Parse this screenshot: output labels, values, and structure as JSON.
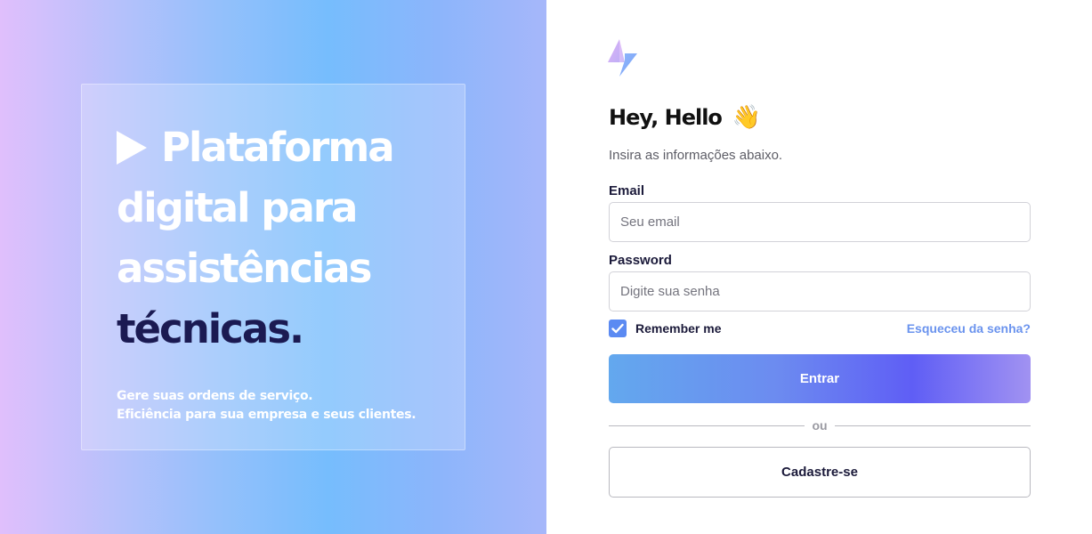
{
  "hero": {
    "headline_line1": "Plataforma",
    "headline_line2": "digital para",
    "headline_line3": "assistências",
    "headline_line4": "técnicas.",
    "subtext_line1": "Gere suas ordens de serviço.",
    "subtext_line2": "Eficiência para sua empresa e seus clientes.",
    "play_icon": "play-icon"
  },
  "brand": {
    "logo_icon": "lightning-bolt-icon",
    "colors": {
      "accent": "#5f5ef5",
      "link": "#6a93ee",
      "heading_dark": "#1b1a52"
    }
  },
  "login": {
    "greeting": "Hey, Hello",
    "wave_emoji": "👋",
    "intro": "Insira as informações abaixo.",
    "email_label": "Email",
    "email_placeholder": "Seu email",
    "email_value": "",
    "password_label": "Password",
    "password_placeholder": "Digite sua senha",
    "password_value": "",
    "remember_label": "Remember me",
    "remember_checked": true,
    "forgot_link": "Esqueceu da senha?",
    "submit_label": "Entrar",
    "divider_label": "ou",
    "signup_label": "Cadastre-se"
  }
}
